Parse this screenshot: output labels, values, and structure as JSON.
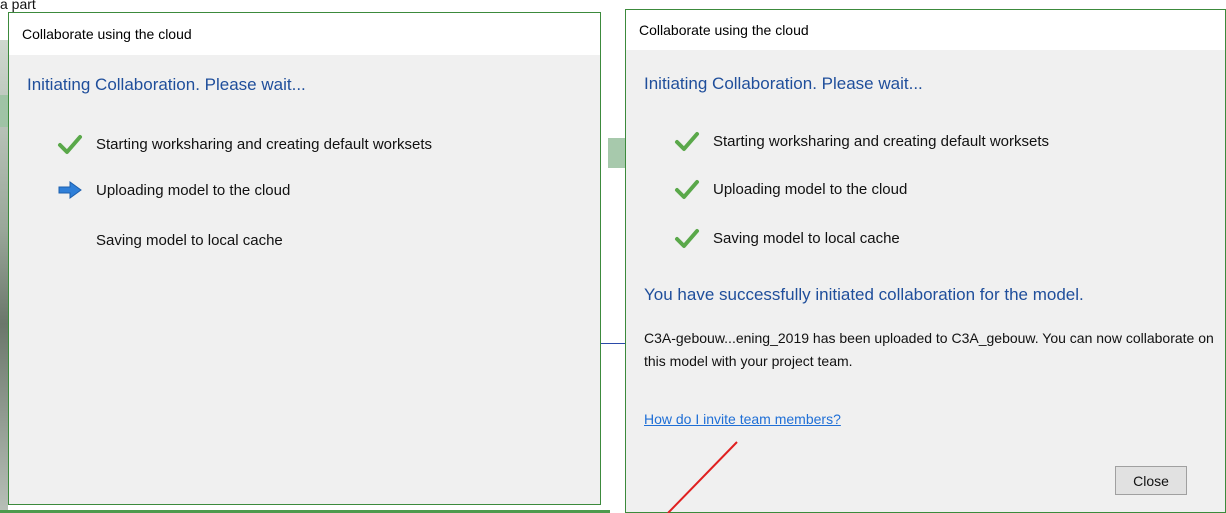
{
  "background": {
    "top_fragment_text": "a part"
  },
  "left_dialog": {
    "title": "Collaborate using the cloud",
    "heading": "Initiating Collaboration. Please wait...",
    "steps": [
      {
        "label": "Starting worksharing and creating default worksets",
        "status": "done",
        "icon": "check-icon"
      },
      {
        "label": "Uploading model to the cloud",
        "status": "in-progress",
        "icon": "arrow-right-icon"
      },
      {
        "label": "Saving model to local cache",
        "status": "pending",
        "icon": ""
      }
    ]
  },
  "right_dialog": {
    "title": "Collaborate using the cloud",
    "heading": "Initiating Collaboration. Please wait...",
    "steps": [
      {
        "label": "Starting worksharing and creating default worksets",
        "status": "done",
        "icon": "check-icon"
      },
      {
        "label": "Uploading model to the cloud",
        "status": "done",
        "icon": "check-icon"
      },
      {
        "label": "Saving model to local cache",
        "status": "done",
        "icon": "check-icon"
      }
    ],
    "success_message": "You have successfully initiated collaboration for the model.",
    "detail_message": "C3A-gebouw...ening_2019 has been uploaded to C3A_gebouw. You can now collaborate on this model with your project team.",
    "help_link": "How do I invite team members?",
    "close_label": "Close"
  },
  "colors": {
    "heading": "#1f4e9b",
    "link": "#1f6fd6",
    "check": "#5aa84a",
    "arrow": "#2f7fd8",
    "annotation_line": "#e02020",
    "dialog_border": "#3c8a3c"
  }
}
